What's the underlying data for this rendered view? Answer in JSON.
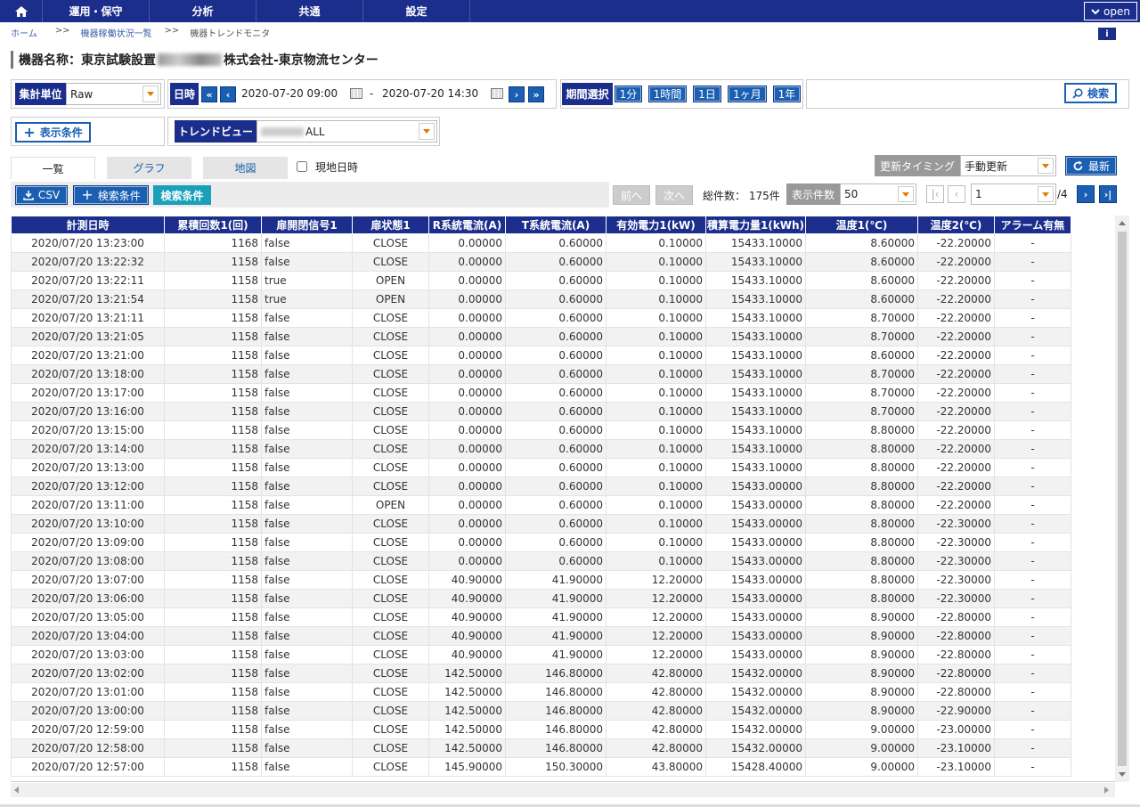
{
  "nav": {
    "menu": [
      "運用・保守",
      "分析",
      "共通",
      "設定"
    ],
    "open_label": "open"
  },
  "breadcrumb": {
    "home": "ホーム",
    "sep": ">>",
    "list": "機器稼働状況一覧",
    "current": "機器トレンドモニタ"
  },
  "title": {
    "prefix": "機器名称：東京試験設置",
    "suffix": "株式会社-東京物流センター"
  },
  "filter": {
    "agg_label": "集計単位",
    "agg_value": "Raw",
    "date_label": "日時",
    "date_from": "2020-07-20 09:00",
    "date_sep": "-",
    "date_to": "2020-07-20 14:30",
    "period_label": "期間選択",
    "periods": [
      "1分",
      "1時間",
      "1日",
      "1ヶ月",
      "1年"
    ],
    "search_label": "検索"
  },
  "display": {
    "cond_label": "表示条件",
    "trend_label": "トレンドビュー",
    "trend_value": "ALL"
  },
  "tabs": [
    "一覧",
    "グラフ",
    "地図"
  ],
  "local_time_label": "現地日時",
  "update": {
    "label": "更新タイミング",
    "value": "手動更新",
    "refresh_label": "最新"
  },
  "toolbar": {
    "csv_label": "CSV",
    "search_cond_label": "検索条件",
    "search_cond_tag": "検索条件",
    "prev_label": "前へ",
    "next_label": "次へ",
    "total_label": "総件数： 175件",
    "page_size_label": "表示件数",
    "page_size_value": "50",
    "page_value": "1",
    "page_total": "/4"
  },
  "table": {
    "headers": [
      "計測日時",
      "累積回数1(回)",
      "扉開閉信号1",
      "扉状態1",
      "R系統電流(A)",
      "T系統電流(A)",
      "有効電力1(kW)",
      "積算電力量1(kWh)",
      "温度1(℃)",
      "温度2(℃)",
      "アラーム有無"
    ],
    "rows": [
      [
        "2020/07/20 13:23:00",
        "1168",
        "false",
        "CLOSE",
        "0.00000",
        "0.60000",
        "0.10000",
        "15433.10000",
        "8.60000",
        "-22.20000",
        "-"
      ],
      [
        "2020/07/20 13:22:32",
        "1158",
        "false",
        "CLOSE",
        "0.00000",
        "0.60000",
        "0.10000",
        "15433.10000",
        "8.60000",
        "-22.20000",
        "-"
      ],
      [
        "2020/07/20 13:22:11",
        "1158",
        "true",
        "OPEN",
        "0.00000",
        "0.60000",
        "0.10000",
        "15433.10000",
        "8.60000",
        "-22.20000",
        "-"
      ],
      [
        "2020/07/20 13:21:54",
        "1158",
        "true",
        "OPEN",
        "0.00000",
        "0.60000",
        "0.10000",
        "15433.10000",
        "8.60000",
        "-22.20000",
        "-"
      ],
      [
        "2020/07/20 13:21:11",
        "1158",
        "false",
        "CLOSE",
        "0.00000",
        "0.60000",
        "0.10000",
        "15433.10000",
        "8.70000",
        "-22.20000",
        "-"
      ],
      [
        "2020/07/20 13:21:05",
        "1158",
        "false",
        "CLOSE",
        "0.00000",
        "0.60000",
        "0.10000",
        "15433.10000",
        "8.70000",
        "-22.20000",
        "-"
      ],
      [
        "2020/07/20 13:21:00",
        "1158",
        "false",
        "CLOSE",
        "0.00000",
        "0.60000",
        "0.10000",
        "15433.10000",
        "8.60000",
        "-22.20000",
        "-"
      ],
      [
        "2020/07/20 13:18:00",
        "1158",
        "false",
        "CLOSE",
        "0.00000",
        "0.60000",
        "0.10000",
        "15433.10000",
        "8.70000",
        "-22.20000",
        "-"
      ],
      [
        "2020/07/20 13:17:00",
        "1158",
        "false",
        "CLOSE",
        "0.00000",
        "0.60000",
        "0.10000",
        "15433.10000",
        "8.70000",
        "-22.20000",
        "-"
      ],
      [
        "2020/07/20 13:16:00",
        "1158",
        "false",
        "CLOSE",
        "0.00000",
        "0.60000",
        "0.10000",
        "15433.10000",
        "8.70000",
        "-22.20000",
        "-"
      ],
      [
        "2020/07/20 13:15:00",
        "1158",
        "false",
        "CLOSE",
        "0.00000",
        "0.60000",
        "0.10000",
        "15433.10000",
        "8.80000",
        "-22.20000",
        "-"
      ],
      [
        "2020/07/20 13:14:00",
        "1158",
        "false",
        "CLOSE",
        "0.00000",
        "0.60000",
        "0.10000",
        "15433.10000",
        "8.80000",
        "-22.20000",
        "-"
      ],
      [
        "2020/07/20 13:13:00",
        "1158",
        "false",
        "CLOSE",
        "0.00000",
        "0.60000",
        "0.10000",
        "15433.10000",
        "8.80000",
        "-22.20000",
        "-"
      ],
      [
        "2020/07/20 13:12:00",
        "1158",
        "false",
        "CLOSE",
        "0.00000",
        "0.60000",
        "0.10000",
        "15433.00000",
        "8.80000",
        "-22.20000",
        "-"
      ],
      [
        "2020/07/20 13:11:00",
        "1158",
        "false",
        "OPEN",
        "0.00000",
        "0.60000",
        "0.10000",
        "15433.00000",
        "8.80000",
        "-22.20000",
        "-"
      ],
      [
        "2020/07/20 13:10:00",
        "1158",
        "false",
        "CLOSE",
        "0.00000",
        "0.60000",
        "0.10000",
        "15433.00000",
        "8.80000",
        "-22.30000",
        "-"
      ],
      [
        "2020/07/20 13:09:00",
        "1158",
        "false",
        "CLOSE",
        "0.00000",
        "0.60000",
        "0.10000",
        "15433.00000",
        "8.80000",
        "-22.30000",
        "-"
      ],
      [
        "2020/07/20 13:08:00",
        "1158",
        "false",
        "CLOSE",
        "0.00000",
        "0.60000",
        "0.10000",
        "15433.00000",
        "8.80000",
        "-22.30000",
        "-"
      ],
      [
        "2020/07/20 13:07:00",
        "1158",
        "false",
        "CLOSE",
        "40.90000",
        "41.90000",
        "12.20000",
        "15433.00000",
        "8.80000",
        "-22.30000",
        "-"
      ],
      [
        "2020/07/20 13:06:00",
        "1158",
        "false",
        "CLOSE",
        "40.90000",
        "41.90000",
        "12.20000",
        "15433.00000",
        "8.80000",
        "-22.30000",
        "-"
      ],
      [
        "2020/07/20 13:05:00",
        "1158",
        "false",
        "CLOSE",
        "40.90000",
        "41.90000",
        "12.20000",
        "15433.00000",
        "8.90000",
        "-22.80000",
        "-"
      ],
      [
        "2020/07/20 13:04:00",
        "1158",
        "false",
        "CLOSE",
        "40.90000",
        "41.90000",
        "12.20000",
        "15433.00000",
        "8.90000",
        "-22.80000",
        "-"
      ],
      [
        "2020/07/20 13:03:00",
        "1158",
        "false",
        "CLOSE",
        "40.90000",
        "41.90000",
        "12.20000",
        "15433.00000",
        "8.90000",
        "-22.80000",
        "-"
      ],
      [
        "2020/07/20 13:02:00",
        "1158",
        "false",
        "CLOSE",
        "142.50000",
        "146.80000",
        "42.80000",
        "15432.00000",
        "8.90000",
        "-22.80000",
        "-"
      ],
      [
        "2020/07/20 13:01:00",
        "1158",
        "false",
        "CLOSE",
        "142.50000",
        "146.80000",
        "42.80000",
        "15432.00000",
        "8.90000",
        "-22.80000",
        "-"
      ],
      [
        "2020/07/20 13:00:00",
        "1158",
        "false",
        "CLOSE",
        "142.50000",
        "146.80000",
        "42.80000",
        "15432.00000",
        "8.90000",
        "-22.90000",
        "-"
      ],
      [
        "2020/07/20 12:59:00",
        "1158",
        "false",
        "CLOSE",
        "142.50000",
        "146.80000",
        "42.80000",
        "15432.00000",
        "9.00000",
        "-23.00000",
        "-"
      ],
      [
        "2020/07/20 12:58:00",
        "1158",
        "false",
        "CLOSE",
        "142.50000",
        "146.80000",
        "42.80000",
        "15432.00000",
        "9.00000",
        "-23.10000",
        "-"
      ],
      [
        "2020/07/20 12:57:00",
        "1158",
        "false",
        "CLOSE",
        "145.90000",
        "150.30000",
        "43.80000",
        "15428.40000",
        "9.00000",
        "-23.10000",
        "-"
      ]
    ]
  }
}
